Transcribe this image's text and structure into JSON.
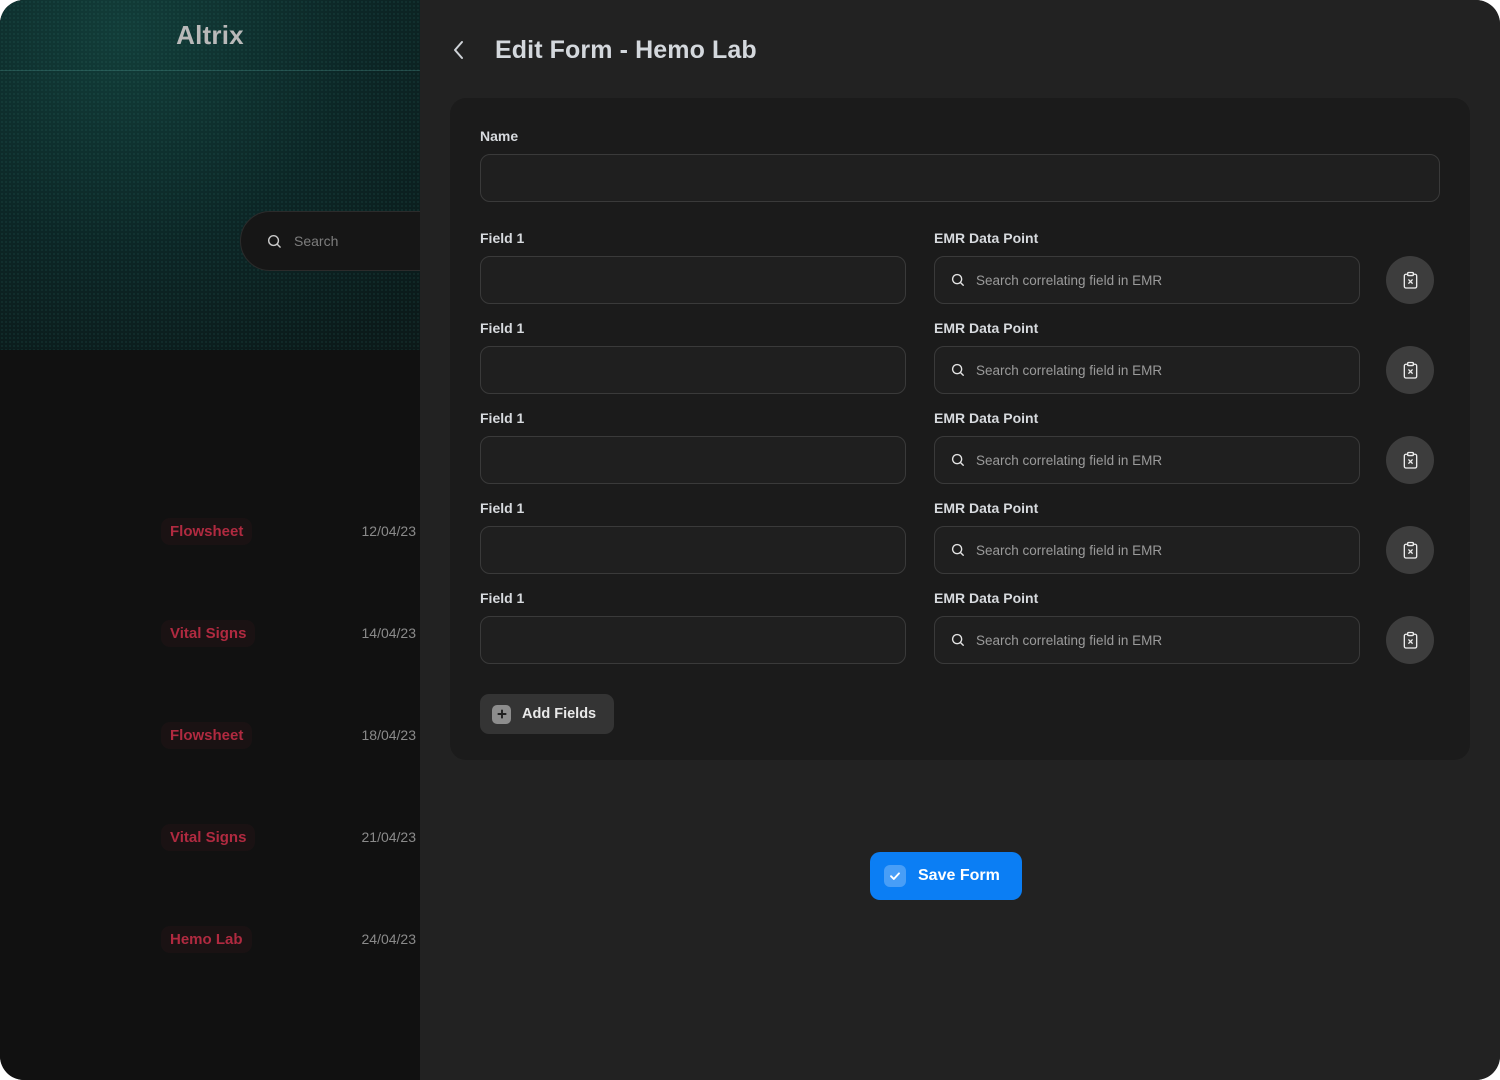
{
  "window": {
    "background": "#222222"
  },
  "sidebar": {
    "brand": "Altrix",
    "search": {
      "placeholder": "Search",
      "icon": "search-icon"
    },
    "accent_color": "#b02a40",
    "items": [
      {
        "label": "Flowsheet",
        "date": "12/04/23"
      },
      {
        "label": "Vital Signs",
        "date": "14/04/23"
      },
      {
        "label": "Flowsheet",
        "date": "18/04/23"
      },
      {
        "label": "Vital Signs",
        "date": "21/04/23"
      },
      {
        "label": "Hemo Lab",
        "date": "24/04/23"
      }
    ]
  },
  "header": {
    "back_icon": "chevron-left-icon",
    "title": "Edit Form - Hemo Lab"
  },
  "form": {
    "name": {
      "label": "Name",
      "value": "",
      "placeholder": ""
    },
    "rows": [
      {
        "field_label": "Field 1",
        "field_value": "",
        "emr_label": "EMR Data Point",
        "emr_placeholder": "Search correlating field in EMR",
        "emr_value": "",
        "remove_icon": "clipboard-x-icon"
      },
      {
        "field_label": "Field 1",
        "field_value": "",
        "emr_label": "EMR Data Point",
        "emr_placeholder": "Search correlating field in EMR",
        "emr_value": "",
        "remove_icon": "clipboard-x-icon"
      },
      {
        "field_label": "Field 1",
        "field_value": "",
        "emr_label": "EMR Data Point",
        "emr_placeholder": "Search correlating field in EMR",
        "emr_value": "",
        "remove_icon": "clipboard-x-icon"
      },
      {
        "field_label": "Field 1",
        "field_value": "",
        "emr_label": "EMR Data Point",
        "emr_placeholder": "Search correlating field in EMR",
        "emr_value": "",
        "remove_icon": "clipboard-x-icon"
      },
      {
        "field_label": "Field 1",
        "field_value": "",
        "emr_label": "EMR Data Point",
        "emr_placeholder": "Search correlating field in EMR",
        "emr_value": "",
        "remove_icon": "clipboard-x-icon"
      }
    ],
    "add_fields_label": "Add Fields",
    "add_fields_icon": "plus-icon"
  },
  "actions": {
    "save_label": "Save Form",
    "save_icon": "check-circle-icon",
    "save_color": "#0b7ef4"
  }
}
